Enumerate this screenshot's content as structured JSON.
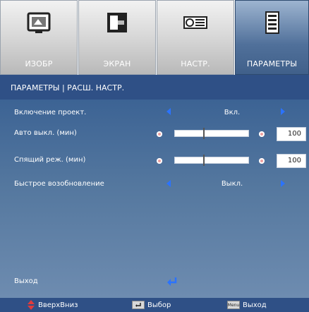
{
  "tabs": [
    {
      "label": "ИЗОБР",
      "icon": "image-icon",
      "active": false
    },
    {
      "label": "ЭКРАН",
      "icon": "screen-icon",
      "active": false
    },
    {
      "label": "НАСТР.",
      "icon": "projector-icon",
      "active": false
    },
    {
      "label": "ПАРАМЕТРЫ",
      "icon": "options-list-icon",
      "active": true
    }
  ],
  "header": {
    "title": "ПАРАМЕТРЫ | РАСШ. НАСТР."
  },
  "settings": {
    "power_on": {
      "label": "Включение проект.",
      "value": "Вкл."
    },
    "auto_off": {
      "label": "Авто выкл. (мин)",
      "value": "100",
      "level": 0.38
    },
    "sleep": {
      "label": "Спящий реж. (мин)",
      "value": "100",
      "level": 0.38
    },
    "quick_resume": {
      "label": "Быстрое возобновление",
      "value": "Выкл."
    }
  },
  "exit": {
    "label": "Выход"
  },
  "footer": {
    "updown": "ВверхВниз",
    "select": "Выбор",
    "exit": "Выход",
    "menu_key": "Menu"
  },
  "colors": {
    "header_bg": "#2f5086",
    "panel_top": "#3c6394",
    "panel_bottom": "#6e8cb0",
    "arrow": "#2b73ff",
    "active_tab": "#50709a"
  }
}
